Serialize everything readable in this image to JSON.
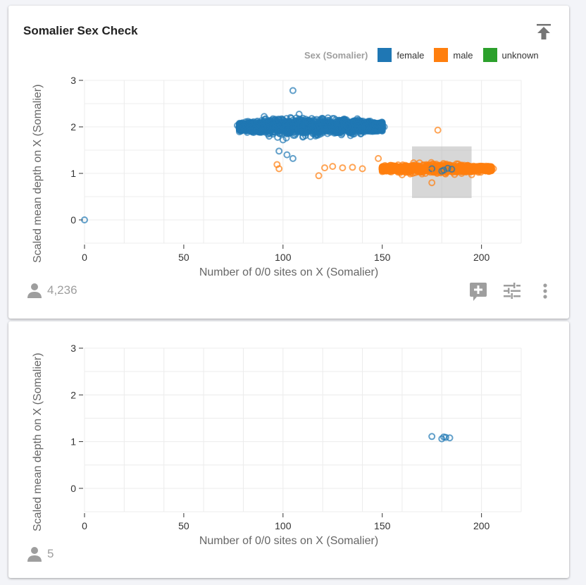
{
  "cards": [
    {
      "title": "Somalier Sex Check",
      "legend": {
        "title": "Sex (Somalier)",
        "items": [
          {
            "label": "female",
            "color": "#1f77b4"
          },
          {
            "label": "male",
            "color": "#ff7f0e"
          },
          {
            "label": "unknown",
            "color": "#2ca02c"
          }
        ]
      },
      "count": "4,236",
      "icons": [
        "pin-to-top-icon",
        "add-comment-icon",
        "tune-icon",
        "more-vert-icon"
      ]
    },
    {
      "count": "5",
      "icons": []
    }
  ],
  "chart_data": [
    {
      "type": "scatter",
      "title": "Somalier Sex Check",
      "xlabel": "Number of 0/0 sites on X (Somalier)",
      "ylabel": "Scaled mean depth on X (Somalier)",
      "xlim": [
        0,
        220
      ],
      "ylim": [
        -0.5,
        3
      ],
      "xticks": [
        "0",
        "50",
        "100",
        "150",
        "200"
      ],
      "yticks": [
        "0",
        "1",
        "2",
        "3"
      ],
      "grid": true,
      "legend_position": "top-right",
      "selection_box": {
        "x": [
          165,
          195
        ],
        "y": [
          0.47,
          1.58
        ]
      },
      "series": [
        {
          "name": "female",
          "color": "#1f77b4",
          "cluster": {
            "x_range": [
              78,
              150
            ],
            "y_center": 2.0,
            "y_spread": 0.08,
            "n": 3000
          },
          "points": [
            [
              0,
              0
            ],
            [
              105,
              2.78
            ],
            [
              77,
              2.03
            ],
            [
              80,
              2.0
            ],
            [
              147,
              1.98
            ],
            [
              151,
              2.0
            ],
            [
              143,
              1.98
            ],
            [
              106,
              1.82
            ],
            [
              98,
              1.48
            ],
            [
              102,
              1.4
            ],
            [
              105,
              1.32
            ],
            [
              93,
              1.8
            ],
            [
              120,
              2.18
            ],
            [
              130,
              2.15
            ],
            [
              128,
              2.08
            ],
            [
              100,
              1.72
            ],
            [
              110,
              1.78
            ],
            [
              175,
              1.1
            ],
            [
              181,
              1.07
            ],
            [
              183,
              1.11
            ],
            [
              185,
              1.09
            ],
            [
              180,
              1.05
            ]
          ]
        },
        {
          "name": "male",
          "color": "#ff7f0e",
          "cluster": {
            "x_range": [
              150,
              205
            ],
            "y_center": 1.1,
            "y_spread": 0.05,
            "n": 1200
          },
          "points": [
            [
              178,
              1.93
            ],
            [
              97,
              1.19
            ],
            [
              98,
              1.1
            ],
            [
              118,
              0.95
            ],
            [
              121,
              1.12
            ],
            [
              125,
              1.15
            ],
            [
              130,
              1.12
            ],
            [
              135,
              1.13
            ],
            [
              140,
              1.1
            ],
            [
              148,
              1.32
            ],
            [
              175,
              0.8
            ],
            [
              174,
              1.05
            ],
            [
              206,
              1.1
            ],
            [
              203,
              1.1
            ],
            [
              160,
              0.97
            ],
            [
              190,
              1.0
            ]
          ]
        },
        {
          "name": "unknown",
          "color": "#2ca02c",
          "points": []
        }
      ]
    },
    {
      "type": "scatter",
      "xlabel": "Number of 0/0 sites on X (Somalier)",
      "ylabel": "Scaled mean depth on X (Somalier)",
      "xlim": [
        0,
        220
      ],
      "ylim": [
        -0.5,
        3
      ],
      "xticks": [
        "0",
        "50",
        "100",
        "150",
        "200"
      ],
      "yticks": [
        "0",
        "1",
        "2",
        "3"
      ],
      "grid": true,
      "series": [
        {
          "name": "female",
          "color": "#1f77b4",
          "points": [
            [
              175,
              1.11
            ],
            [
              181,
              1.1
            ],
            [
              180,
              1.06
            ],
            [
              182,
              1.09
            ],
            [
              184,
              1.08
            ]
          ]
        }
      ]
    }
  ]
}
